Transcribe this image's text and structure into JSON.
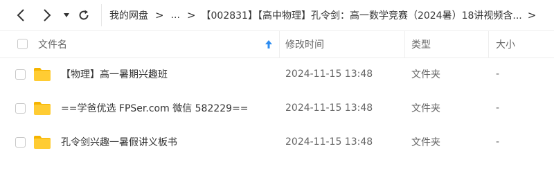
{
  "nav": {
    "back_icon": "chevron-left-icon",
    "forward_icon": "chevron-right-icon",
    "history_icon": "caret-down-icon",
    "refresh_icon": "refresh-icon"
  },
  "breadcrumb": {
    "root": "我的网盘",
    "sep": ">",
    "ellipsis": "...",
    "current": "【002831】【高中物理】孔令剑：高一数学竞赛（2024暑）18讲视频含...",
    "trailing_sep": ">"
  },
  "table": {
    "columns": {
      "name": "文件名",
      "modified": "修改时间",
      "type": "类型",
      "size": "大小"
    },
    "sort_icon": "sort-ascending-arrow-icon",
    "accent_color": "#2d8cf0",
    "rows": [
      {
        "name": "【物理】高一暑期兴趣班",
        "modified": "2024-11-15 13:48",
        "type": "文件夹",
        "size": "-"
      },
      {
        "name": "==学爸优选 FPSer.com 微信 582229==",
        "modified": "2024-11-15 13:48",
        "type": "文件夹",
        "size": "-"
      },
      {
        "name": "孔令剑兴趣一暑假讲义板书",
        "modified": "2024-11-15 13:48",
        "type": "文件夹",
        "size": "-"
      }
    ]
  },
  "colors": {
    "folder_body": "#ffcc33",
    "folder_tab": "#f5b400"
  }
}
